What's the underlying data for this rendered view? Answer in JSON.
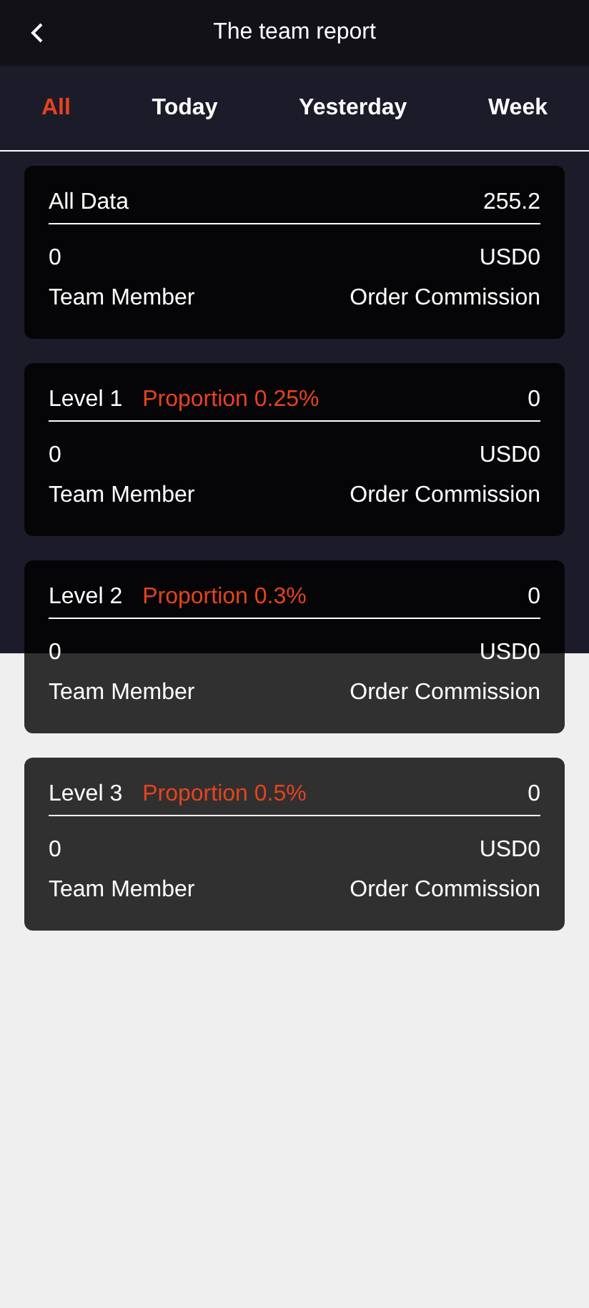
{
  "header": {
    "title": "The team report"
  },
  "tabs": [
    {
      "label": "All",
      "selected": true
    },
    {
      "label": "Today",
      "selected": false
    },
    {
      "label": "Yesterday",
      "selected": false
    },
    {
      "label": "Week",
      "selected": false
    }
  ],
  "cards": [
    {
      "title": "All Data",
      "value": "255.2",
      "members": "0",
      "commission": "USD0",
      "members_label": "Team Member",
      "commission_label": "Order Commission"
    },
    {
      "title": "Level 1",
      "proportion": "Proportion 0.25%",
      "value": "0",
      "members": "0",
      "commission": "USD0",
      "members_label": "Team Member",
      "commission_label": "Order Commission"
    },
    {
      "title": "Level 2",
      "proportion": "Proportion 0.3%",
      "value": "0",
      "members": "0",
      "commission": "USD0",
      "members_label": "Team Member",
      "commission_label": "Order Commission"
    },
    {
      "title": "Level 3",
      "proportion": "Proportion 0.5%",
      "value": "0",
      "members": "0",
      "commission": "USD0",
      "members_label": "Team Member",
      "commission_label": "Order Commission"
    }
  ]
}
